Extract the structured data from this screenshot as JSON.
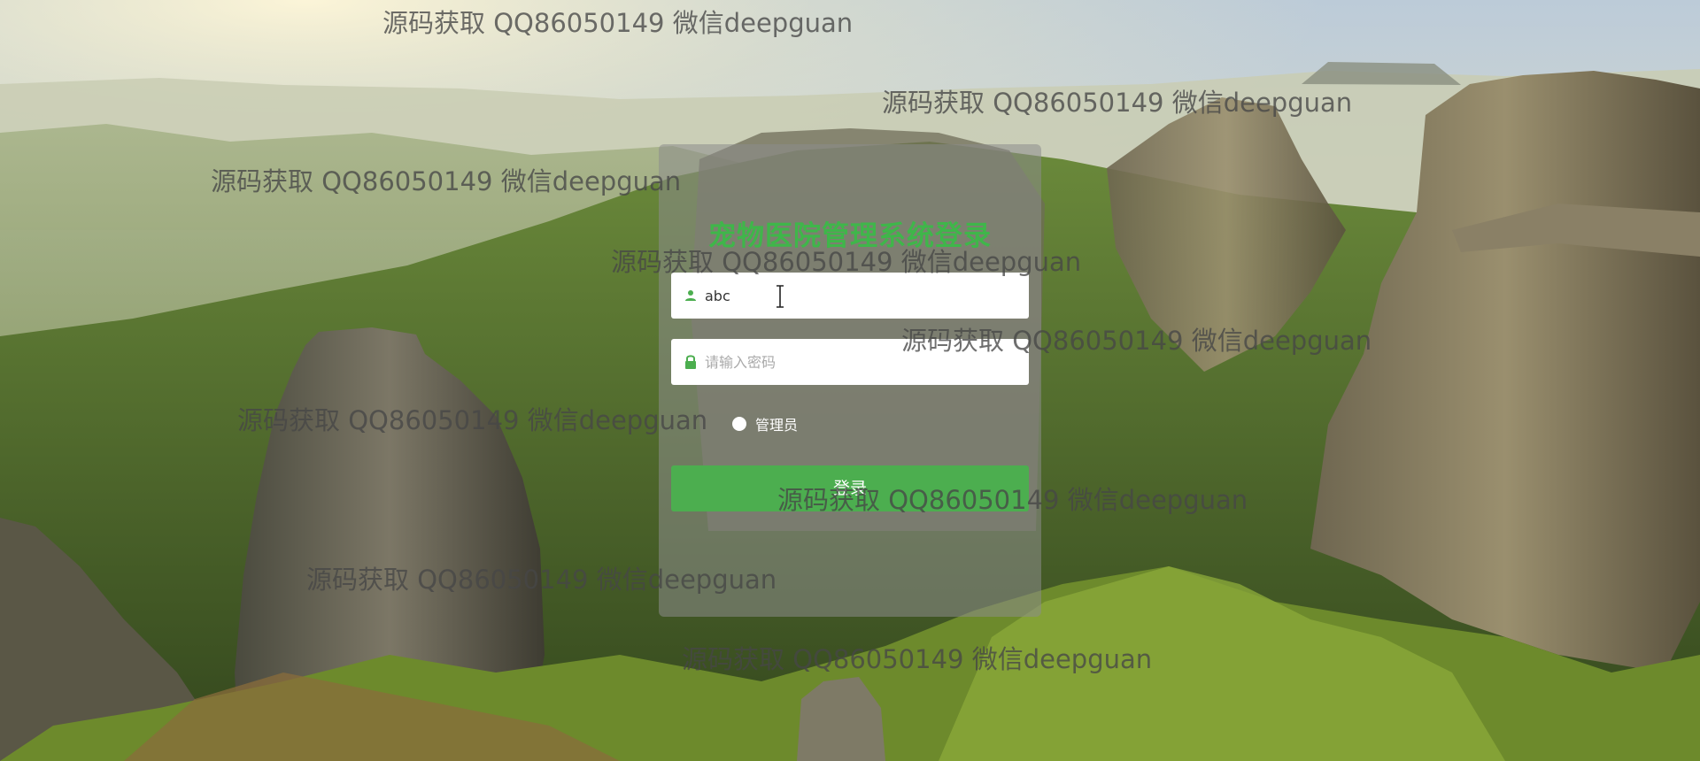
{
  "login": {
    "title": "宠物医院管理系统登录",
    "username_value": "abc",
    "password_placeholder": "请输入密码",
    "role_label": "管理员",
    "submit_label": "登录"
  },
  "watermarks": [
    "源码获取 QQ86050149 微信deepguan",
    "源码获取 QQ86050149 微信deepguan",
    "源码获取 QQ86050149 微信deepguan",
    "源码获取 QQ86050149 微信deepguan",
    "源码获取 QQ86050149 微信deepguan",
    "源码获取 QQ86050149 微信deepguan",
    "源码获取 QQ86050149 微信deepguan",
    "源码获取 QQ86050149 微信deepguan",
    "源码获取 QQ86050149 微信deepguan"
  ],
  "icons": {
    "username": "user-icon",
    "password": "lock-icon",
    "pointer": "text-cursor-icon"
  },
  "colors": {
    "accent": "#4cae4f",
    "title": "#3fb64a"
  }
}
